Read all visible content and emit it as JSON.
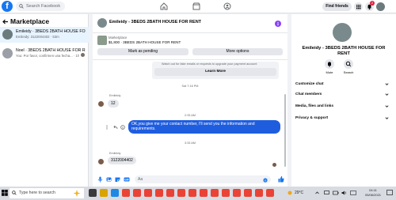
{
  "topbar": {
    "logo": "f",
    "search_placeholder": "Search Facebook",
    "find_friends": "Find friends",
    "notif_badge": "2"
  },
  "left": {
    "title": "Marketplace",
    "chats": [
      {
        "name": "Emileidy · 3BEDS 2BATH HOUSE FOR RENT",
        "sub": "Emileidy: 3122004402 · 53m"
      },
      {
        "name": "Noel · 3BEDS 2BATH HOUSE FOR RENT",
        "sub": "You: Por favor, confirmen una fecha... · 1h"
      }
    ]
  },
  "center": {
    "header_name": "Emileidy - 3BEDS 2BATH HOUSE FOR RENT",
    "listing_label": "Marketplace",
    "listing_title": "$1,800 · 3BEDS 2BATH HOUSE FOR RENT",
    "mark_pending": "Mark as pending",
    "more_options": "More options",
    "warning_text": "Watch out for fake emails or requests to upgrade your payment account",
    "learn_more": "Learn More",
    "ts1": "Sat 7:16 PM",
    "sender1": "Emileidy",
    "msg1": "12",
    "ts2": "2:33 AM",
    "msg_out": "OK,you give me your contact number, I'll send you the information and requirements.",
    "ts3": "3:33 AM",
    "sender2": "Emileidy",
    "msg2": "3122004402",
    "composer_placeholder": "Aa"
  },
  "right": {
    "name": "Emileidy - 3BEDS 2BATH HOUSE FOR RENT",
    "mute": "Mute",
    "search": "Search",
    "menu": [
      "Customize chat",
      "Chat members",
      "Media, files and links",
      "Privacy & support"
    ]
  },
  "taskbar": {
    "search_placeholder": "Type here to search",
    "temp": "29°C",
    "time": "04:11",
    "date": "05/06/2021"
  },
  "colors": {
    "brand": "#1877f2",
    "outgoing_bubble": "#1f5ddf",
    "badge": "#e41e3f"
  }
}
